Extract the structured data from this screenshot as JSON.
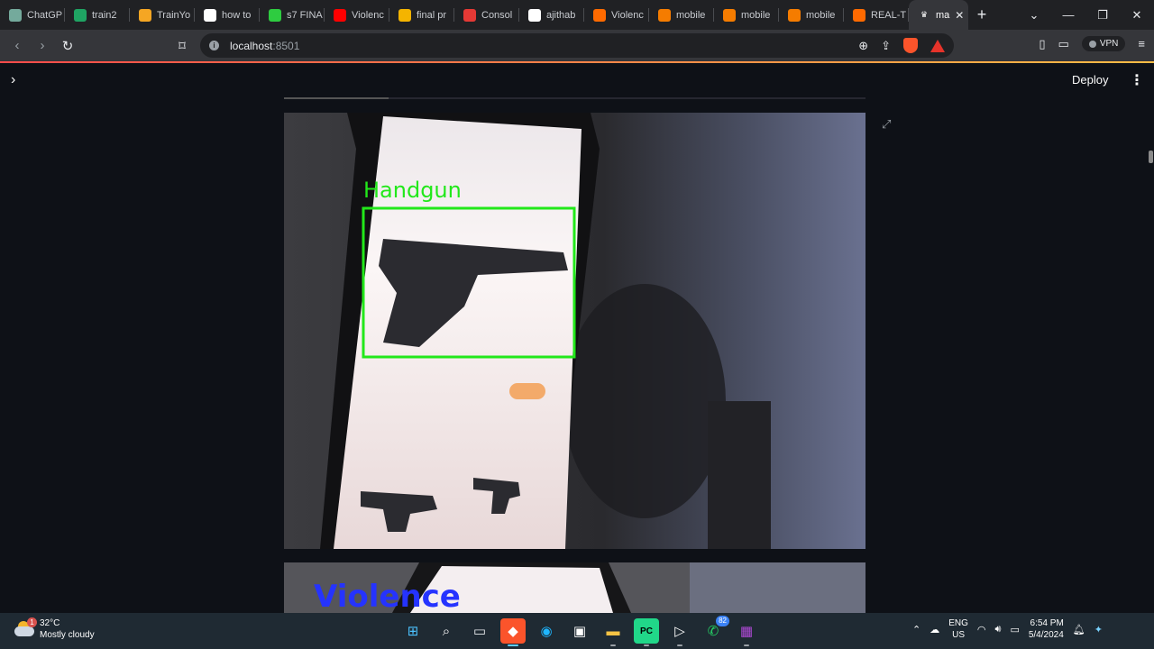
{
  "browser": {
    "tabs": [
      {
        "label": "ChatGP",
        "icon": "chatgpt-icon",
        "color": "#74aa9c"
      },
      {
        "label": "train2",
        "icon": "drive-icon",
        "color": "#1fa463"
      },
      {
        "label": "TrainYo",
        "icon": "infinity-icon",
        "color": "#f5a623"
      },
      {
        "label": "how to",
        "icon": "google-icon",
        "color": "#ffffff"
      },
      {
        "label": "s7 FINA",
        "icon": "leaf-icon",
        "color": "#2ecc40"
      },
      {
        "label": "Violenc",
        "icon": "youtube-icon",
        "color": "#ff0000"
      },
      {
        "label": "final pr",
        "icon": "slides-icon",
        "color": "#f4b400"
      },
      {
        "label": "Consol",
        "icon": "console-icon",
        "color": "#e53935"
      },
      {
        "label": "ajithab",
        "icon": "github-icon",
        "color": "#ffffff"
      },
      {
        "label": "Violenc",
        "icon": "spinner-icon",
        "color": "#ff6a00"
      },
      {
        "label": "mobile",
        "icon": "doc-icon",
        "color": "#f57c00"
      },
      {
        "label": "mobile",
        "icon": "doc-icon",
        "color": "#f57c00"
      },
      {
        "label": "mobile",
        "icon": "doc-icon",
        "color": "#f57c00"
      },
      {
        "label": "REAL-T",
        "icon": "spinner-icon",
        "color": "#ff6a00"
      }
    ],
    "active_tab": {
      "label": "ma",
      "icon": "streamlit-icon",
      "close": "✕"
    },
    "new_tab": "+",
    "url_host": "localhost",
    "url_port": ":8501",
    "vpn_label": "VPN"
  },
  "app": {
    "deploy_label": "Deploy",
    "progress_fraction": 0.18,
    "detections": [
      {
        "label": "Handgun",
        "color": "#22e81a"
      },
      {
        "label": "Violence",
        "color": "#2533ff"
      }
    ]
  },
  "taskbar": {
    "weather_temp": "32°C",
    "weather_desc": "Mostly cloudy",
    "weather_badge": "1",
    "whatsapp_badge": "82",
    "lang_line1": "ENG",
    "lang_line2": "US",
    "time": "6:54 PM",
    "date": "5/4/2024"
  }
}
